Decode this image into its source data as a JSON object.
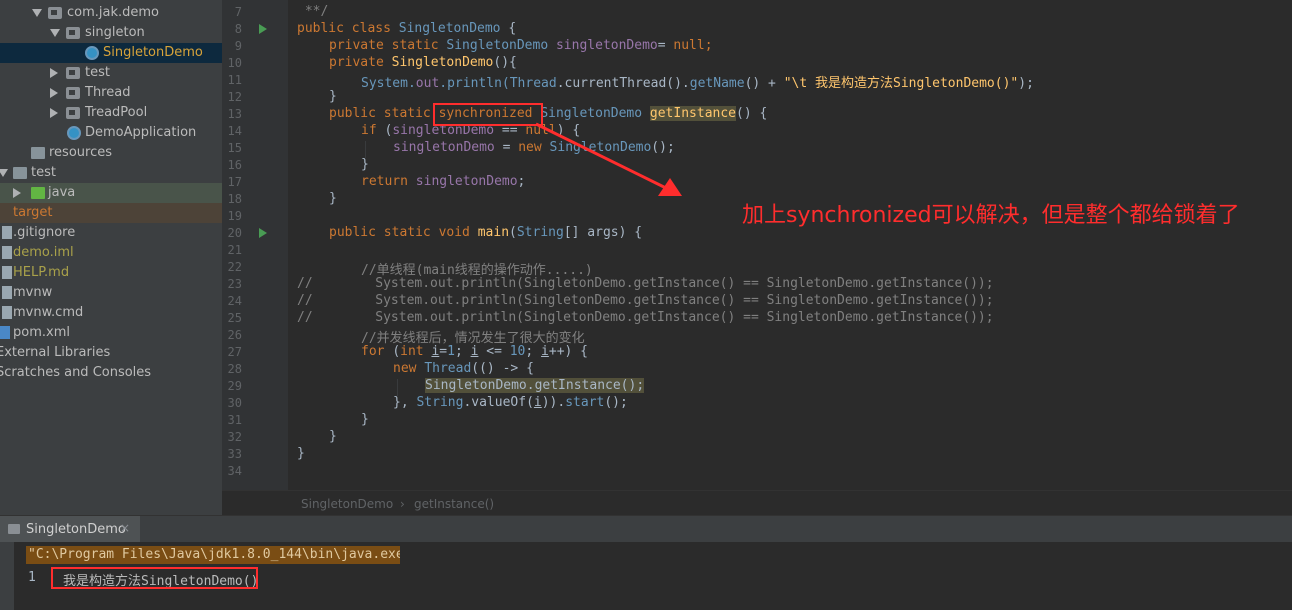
{
  "project_tree": {
    "items": [
      {
        "label": "com.jak.demo"
      },
      {
        "label": "singleton"
      },
      {
        "label": "SingletonDemo"
      },
      {
        "label": "test"
      },
      {
        "label": "Thread"
      },
      {
        "label": "TreadPool"
      },
      {
        "label": "DemoApplication"
      },
      {
        "label": "resources"
      },
      {
        "label": "test"
      },
      {
        "label": "java"
      },
      {
        "label": "target"
      },
      {
        "label": ".gitignore"
      },
      {
        "label": "demo.iml"
      },
      {
        "label": "HELP.md"
      },
      {
        "label": "mvnw"
      },
      {
        "label": "mvnw.cmd"
      },
      {
        "label": "pom.xml"
      },
      {
        "label": "External Libraries"
      },
      {
        "label": "Scratches and Consoles"
      }
    ]
  },
  "editor": {
    "line_numbers": [
      "7",
      "8",
      "9",
      "10",
      "11",
      "12",
      "13",
      "14",
      "15",
      "16",
      "17",
      "18",
      "19",
      "20",
      "21",
      "22",
      "23",
      "24",
      "25",
      "26",
      "27",
      "28",
      "29",
      "30",
      "31",
      "32",
      "33",
      "34"
    ],
    "code": {
      "l7": " **/",
      "l8_kw": "public class ",
      "l8_name": "SingletonDemo",
      "l8_rest": " {",
      "l9_kw": "private static ",
      "l9_ty": "SingletonDemo",
      "l9_fld": " singletonDemo",
      "l9_rest": "= ",
      "l9_null": "null",
      "l9_end": ";",
      "l10_kw": "private ",
      "l10_fn": "SingletonDemo",
      "l10_rest": "(){",
      "l11_sys": "System.",
      "l11_out": "out",
      "l11_rest": ".println(",
      "l11_thread": "Thread",
      "l11_mid": ".currentThread().",
      "l11_getname": "getName",
      "l11_plus": "() + ",
      "l11_str": "\"\\t 我是构造方法SingletonDemo()\"",
      "l11_end": ");",
      "l12": "}",
      "l13_kw": "public static ",
      "l13_sync": "synchronized",
      "l13_ty": " SingletonDemo ",
      "l13_fn": "getInstance",
      "l13_rest": "() {",
      "l14_kw": "if ",
      "l14_open": "(",
      "l14_fld": "singletonDemo",
      "l14_mid": " == ",
      "l14_null": "null",
      "l14_rest": ") {",
      "l15_fld": "singletonDemo",
      "l15_mid": " = ",
      "l15_new": "new ",
      "l15_ty": "SingletonDemo",
      "l15_rest": "();",
      "l16": "}",
      "l17_kw": "return ",
      "l17_fld": "singletonDemo",
      "l17_rest": ";",
      "l18": "}",
      "l20_kw": "public static void ",
      "l20_fn": "main",
      "l20_open": "(",
      "l20_ty": "String",
      "l20_rest": "[] args) {",
      "l22": "//单线程(main线程的操作动作.....)",
      "l23": "//        System.out.println(SingletonDemo.getInstance() == SingletonDemo.getInstance());",
      "l24": "//        System.out.println(SingletonDemo.getInstance() == SingletonDemo.getInstance());",
      "l25": "//        System.out.println(SingletonDemo.getInstance() == SingletonDemo.getInstance());",
      "l26": "//并发线程后，情况发生了很大的变化",
      "l27_kw": "for ",
      "l27_a": "(",
      "l27_int": "int ",
      "l27_i1": "i",
      "l27_b": "=",
      "l27_n1": "1",
      "l27_c": "; ",
      "l27_i2": "i",
      "l27_d": " <= ",
      "l27_n2": "10",
      "l27_e": "; ",
      "l27_i3": "i",
      "l27_f": "++) {",
      "l28_new": "new ",
      "l28_ty": "Thread",
      "l28_rest": "(() -> {",
      "l29_ty": "SingletonDemo",
      "l29_rest": ".getInstance();",
      "l30_a": "}, ",
      "l30_ty": "String",
      "l30_b": ".valueOf(",
      "l30_i": "i",
      "l30_c": ")).",
      "l30_fn": "start",
      "l30_d": "();",
      "l31": "}",
      "l32": "}",
      "l33": "}"
    }
  },
  "breadcrumb": {
    "class": "SingletonDemo",
    "sep": "›",
    "method": "getInstance()"
  },
  "run_panel": {
    "tab_label": "SingletonDemo",
    "close": "×",
    "command": "\"C:\\Program Files\\Java\\jdk1.8.0_144\\bin\\java.exe\" ...",
    "output_line_number": "1",
    "output_text": "我是构造方法SingletonDemo()"
  },
  "annotation": {
    "text": "加上synchronized可以解决，但是整个都给锁着了"
  },
  "colors": {
    "accent_red": "#ff2d2d",
    "keyword": "#cc7832",
    "function": "#ffc66d",
    "string": "#6a8759",
    "field": "#9876aa"
  }
}
